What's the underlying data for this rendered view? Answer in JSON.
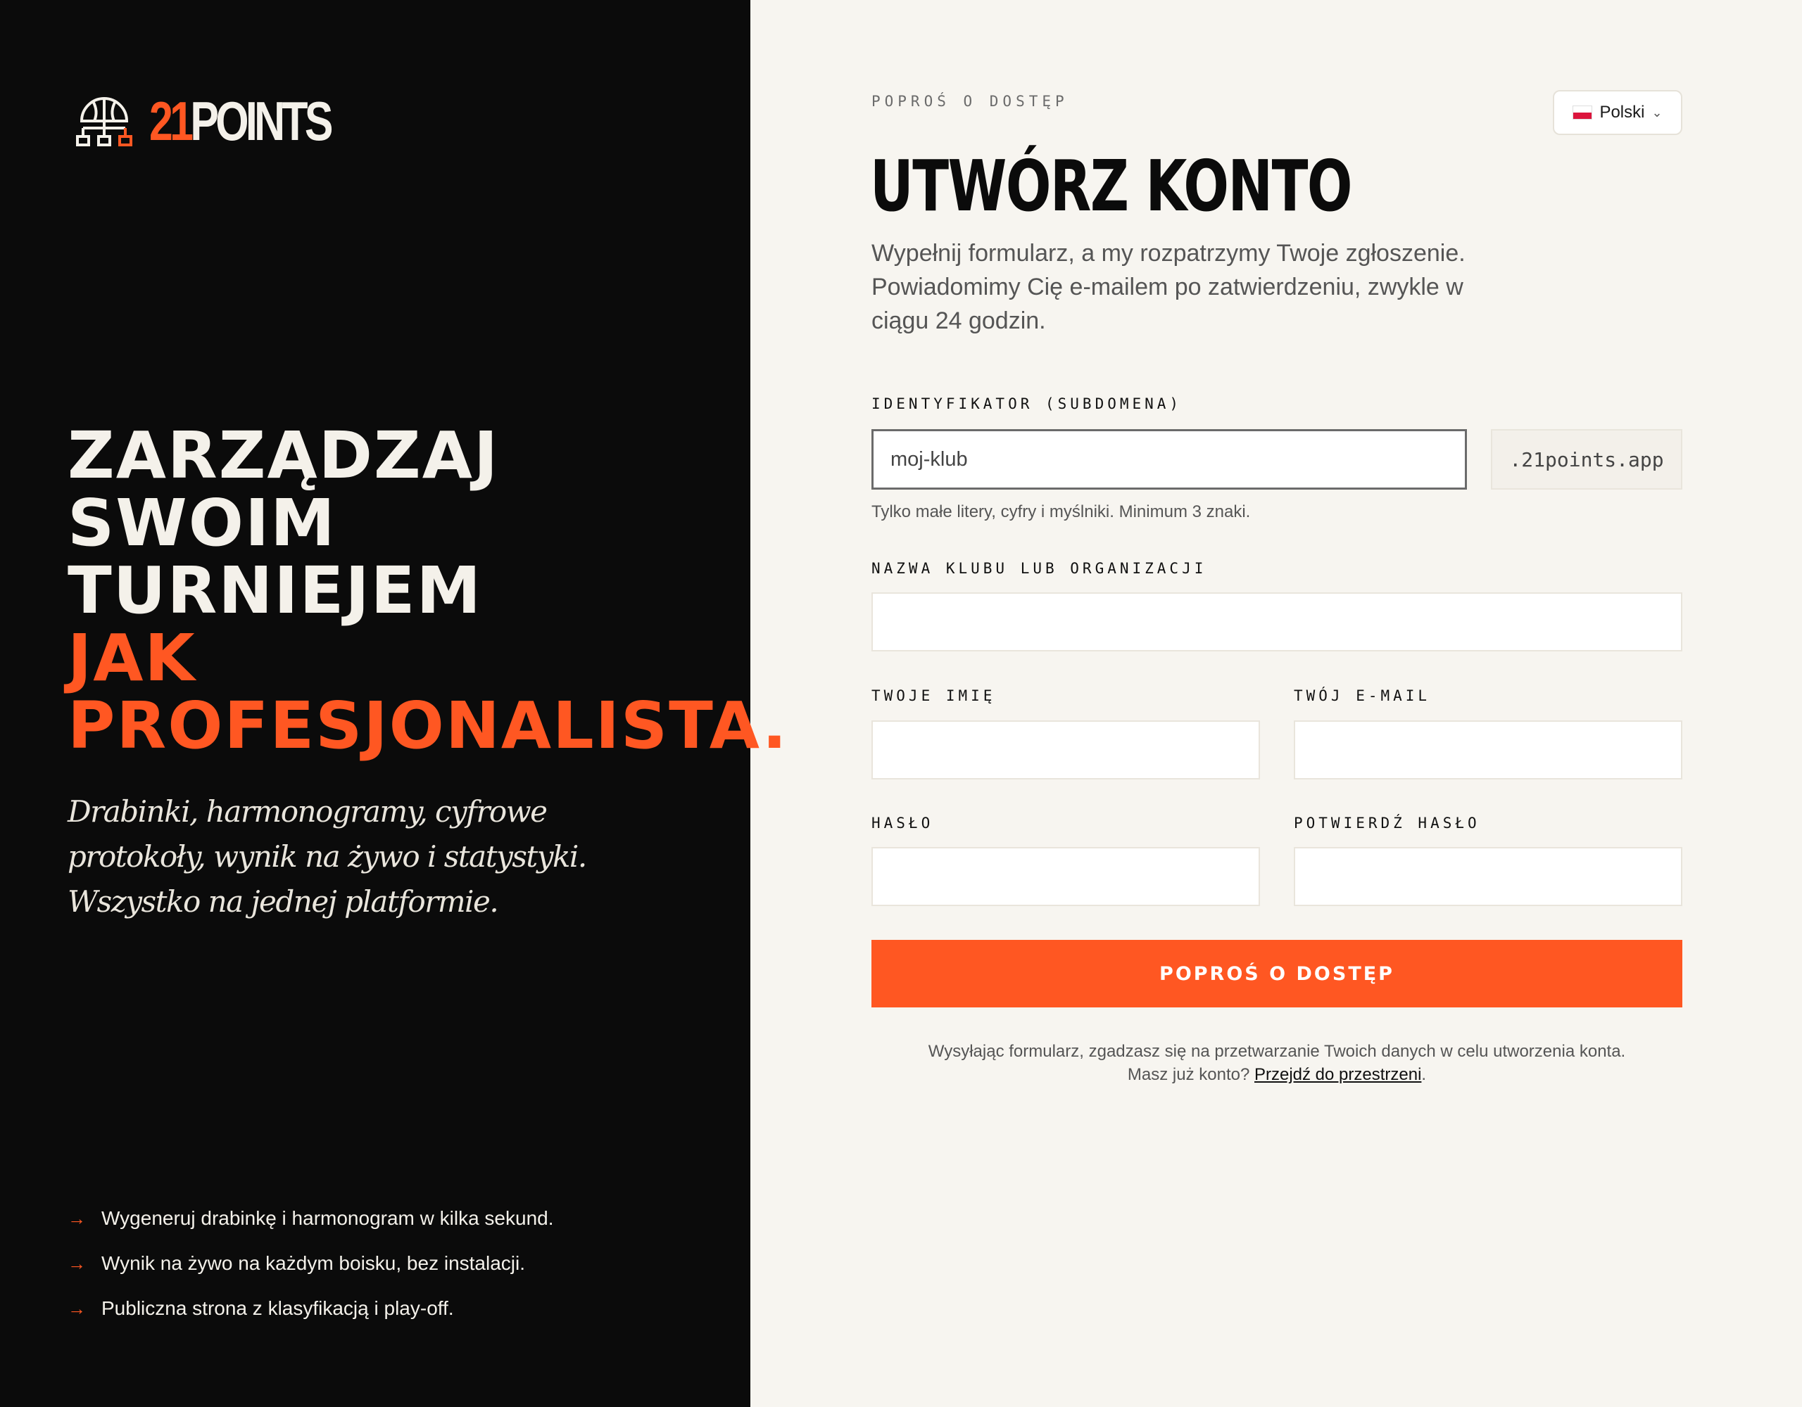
{
  "brand": {
    "logo_number": "21",
    "logo_word": "POINTS"
  },
  "hero": {
    "line1": "ZARZĄDZAJ",
    "line2": "SWOIM",
    "line3": "TURNIEJEM",
    "line4": "JAK",
    "line5": "PROFESJONALISTA.",
    "tagline": "Drabinki, harmonogramy, cyfrowe protokoły, wynik na żywo i statystyki. Wszystko na jednej platformie."
  },
  "features": [
    "Wygeneruj drabinkę i harmonogram w kilka sekund.",
    "Wynik na żywo na każdym boisku, bez instalacji.",
    "Publiczna strona z klasyfikacją i play-off."
  ],
  "form": {
    "eyebrow": "POPROŚ O DOSTĘP",
    "language": "Polski",
    "title": "UTWÓRZ KONTO",
    "description": "Wypełnij formularz, a my rozpatrzymy Twoje zgłoszenie. Powiadomimy Cię e-mailem po zatwierdzeniu, zwykle w ciągu 24 godzin.",
    "subdomain_label": "IDENTYFIKATOR (SUBDOMENA)",
    "subdomain_value": "moj-klub",
    "subdomain_suffix": ".21points.app",
    "subdomain_hint": "Tylko małe litery, cyfry i myślniki. Minimum 3 znaki.",
    "club_label": "NAZWA KLUBU LUB ORGANIZACJI",
    "name_label": "TWOJE IMIĘ",
    "email_label": "TWÓJ E-MAIL",
    "password_label": "HASŁO",
    "confirm_label": "POTWIERDŹ HASŁO",
    "submit_label": "POPROŚ O DOSTĘP",
    "consent_text": "Wysyłając formularz, zgadzasz się na przetwarzanie Twoich danych w celu utworzenia konta.",
    "login_prompt": "Masz już konto?",
    "login_link": "Przejdź do przestrzeni",
    "login_end": "."
  },
  "colors": {
    "accent": "#ff5722",
    "dark": "#0b0b0b",
    "light": "#f7f5f0"
  }
}
